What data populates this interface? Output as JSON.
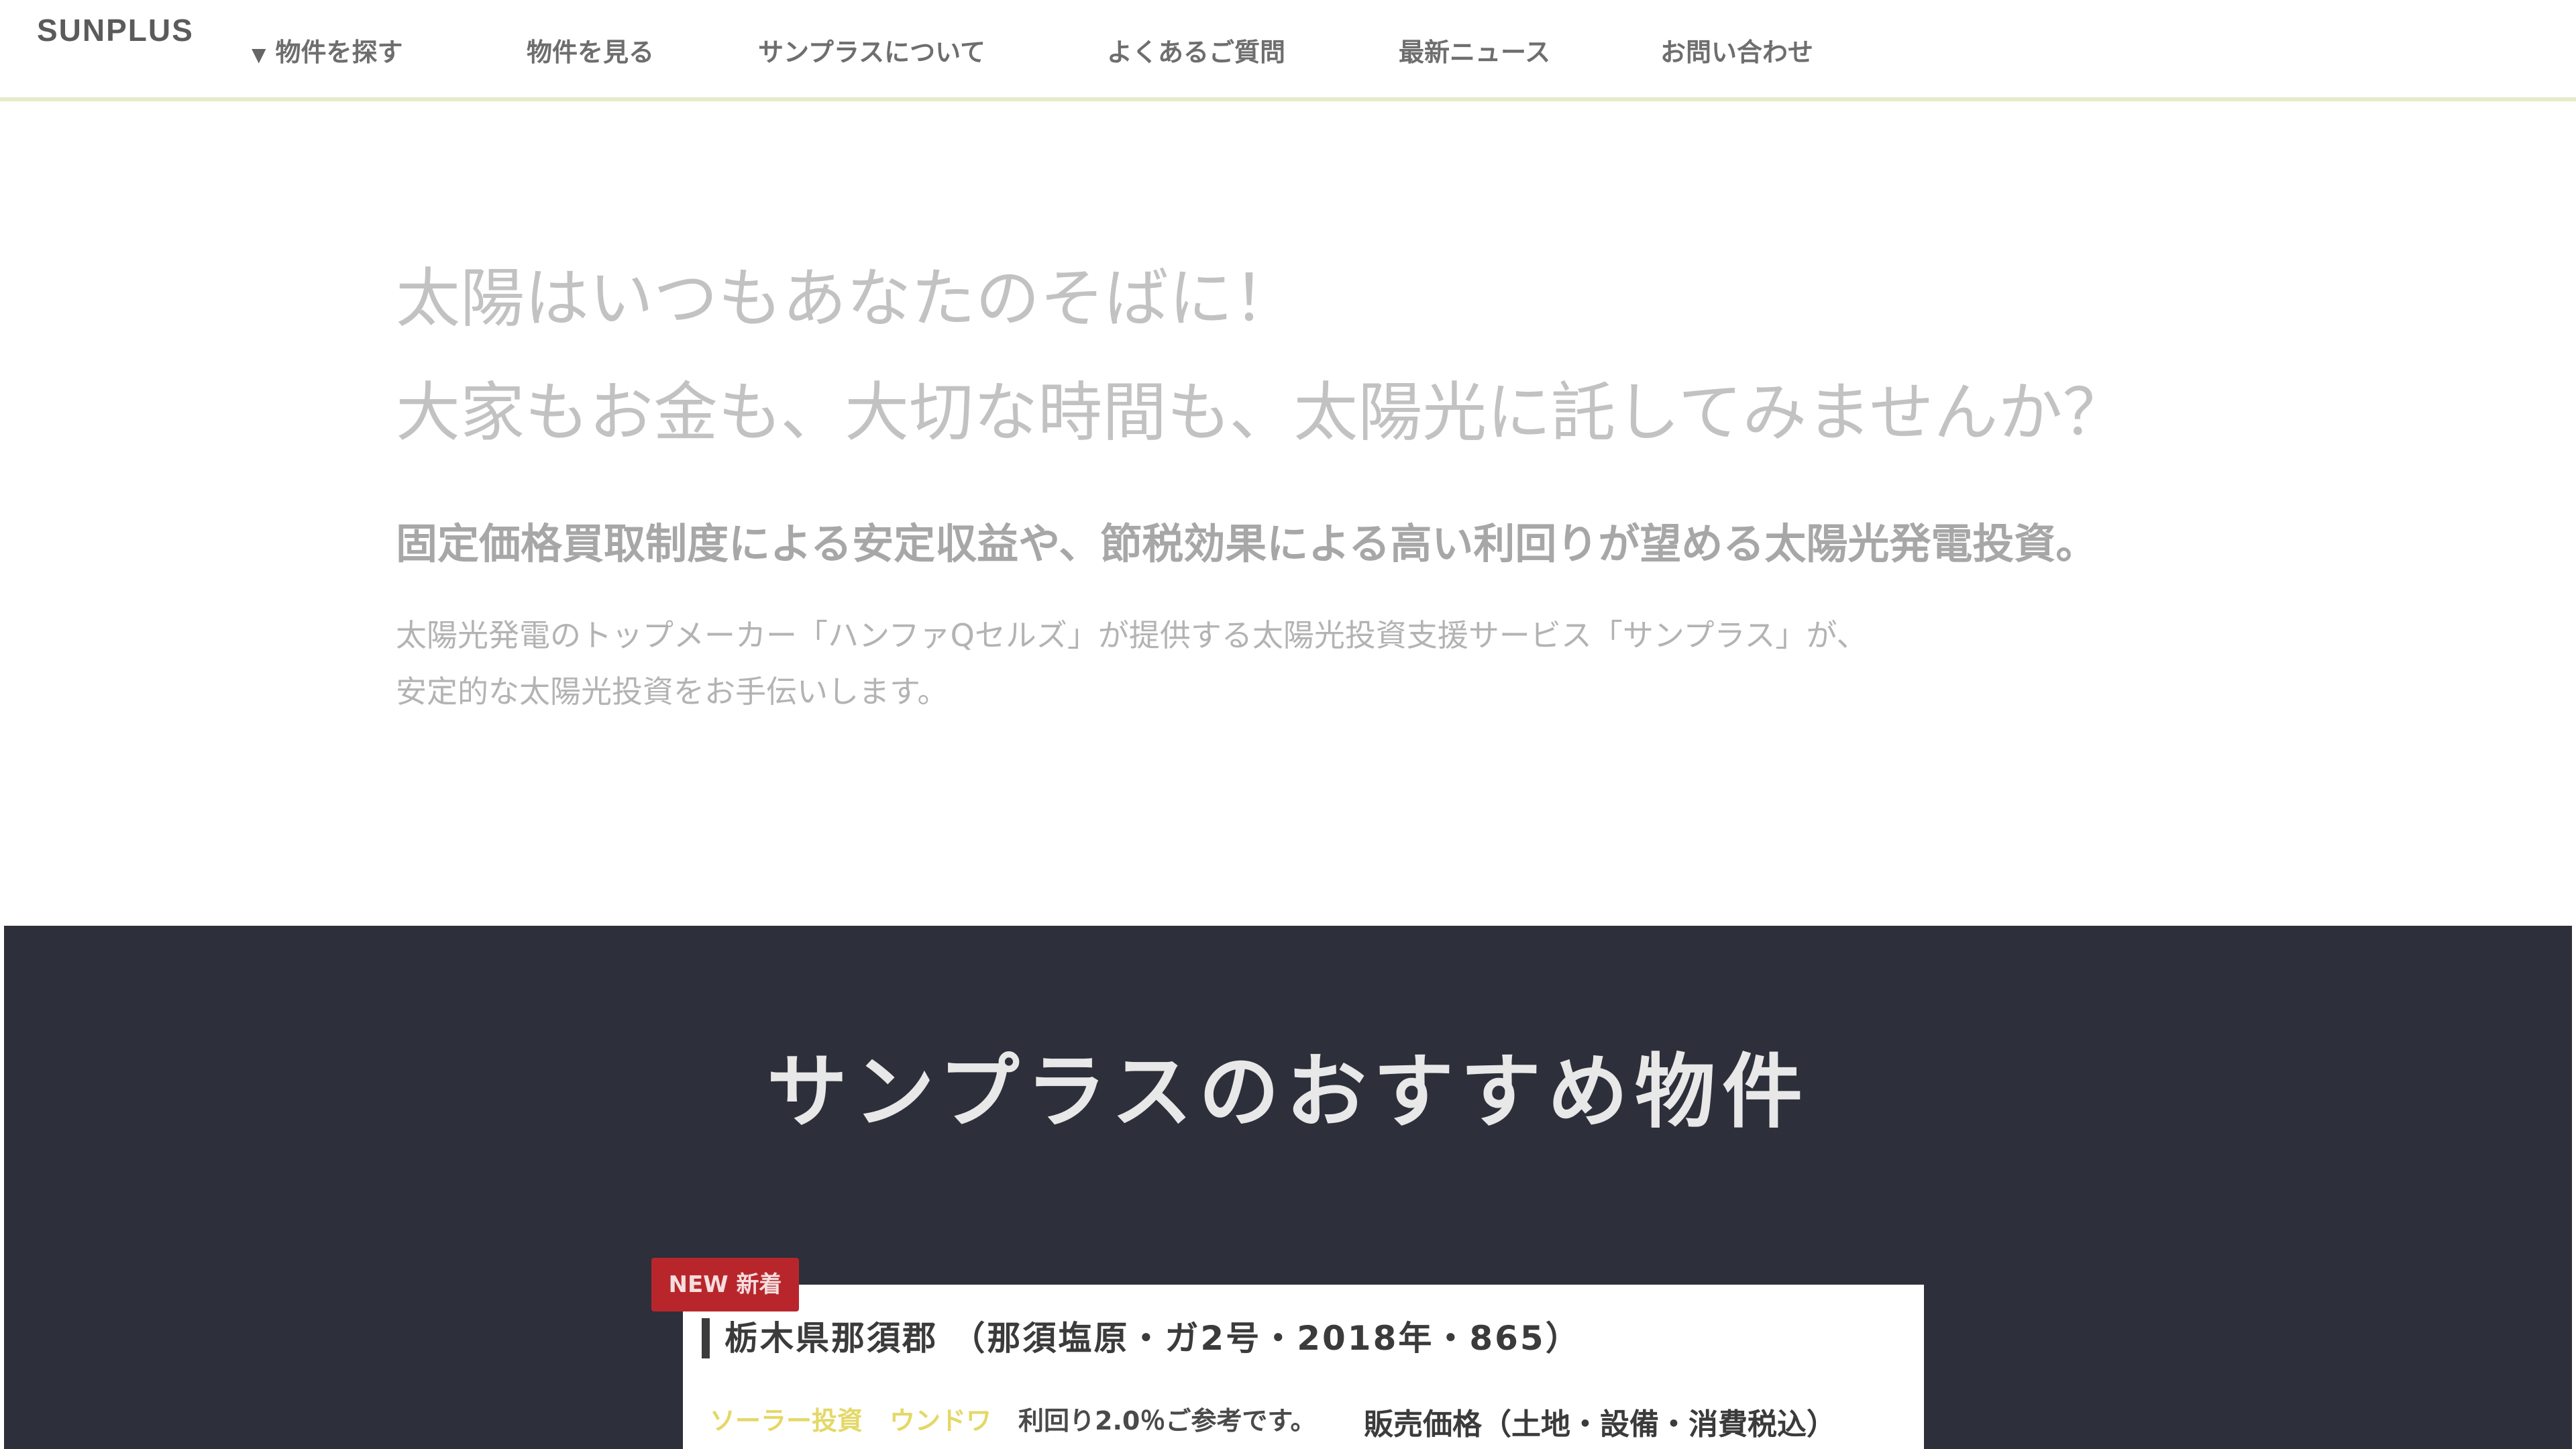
{
  "header": {
    "logo": "SUNPLUS",
    "nav": [
      {
        "label": "物件を探す",
        "has_caret": true
      },
      {
        "label": "物件を見る"
      },
      {
        "label": "サンプラスについて"
      },
      {
        "label": "よくあるご質問"
      },
      {
        "label": "最新ニュース"
      },
      {
        "label": "お問い合わせ"
      }
    ]
  },
  "intro": {
    "headline_line1": "太陽はいつもあなたのそばに！",
    "headline_line2": "大家もお金も、大切な時間も、太陽光に託してみませんか？",
    "lead": "固定価格買取制度による安定収益や、節税効果による高い利回りが望める太陽光発電投資。",
    "body_line1": "太陽光発電のトップメーカー「ハンファQセルズ」が提供する太陽光投資支援サービス「サンプラス」が、",
    "body_line2": "安定的な太陽光投資をお手伝いします。"
  },
  "featured": {
    "title": "サンプラスのおすすめ物件",
    "card": {
      "badge": "NEW 新着",
      "title": "栃木県那須郡 （那須塩原・ガ2号・2018年・865）",
      "tag_accent_1": "ソーラー投資",
      "tag_accent_2": "ウンドワ",
      "tag_note": "利回り2.0％ご参考です。",
      "type": "販売価格（土地・設備・消費税込）"
    }
  },
  "colors": {
    "accent_line": "#e4ecc9",
    "dark_bg": "#2d2f3a",
    "badge_red": "#b8262c",
    "tag_yellow": "#e4d867"
  }
}
